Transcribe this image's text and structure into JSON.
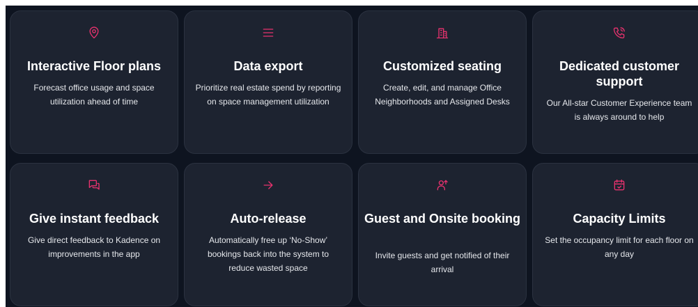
{
  "colors": {
    "background": "#0e1420",
    "card": "#1d2330",
    "accent": "#e8326e",
    "text": "#ffffff"
  },
  "cards": [
    {
      "icon": "map-pin-icon",
      "title": "Interactive Floor plans",
      "description": "Forecast office usage and space utilization ahead of time"
    },
    {
      "icon": "menu-lines-icon",
      "title": "Data export",
      "description": "Prioritize real estate spend by reporting on space management utilization"
    },
    {
      "icon": "building-icon",
      "title": "Customized seating",
      "description": "Create, edit, and manage Office Neighborhoods and Assigned Desks"
    },
    {
      "icon": "phone-call-icon",
      "title": "Dedicated customer support",
      "description": "Our All-star Customer Experience team is always around to help"
    },
    {
      "icon": "chat-bubbles-icon",
      "title": "Give instant feedback",
      "description": "Give direct feedback to Kadence on improvements in the app"
    },
    {
      "icon": "arrow-right-icon",
      "title": "Auto-release",
      "description": "Automatically free up ‘No-Show’ bookings back into the system to reduce wasted space"
    },
    {
      "icon": "user-arrow-icon",
      "title": "Guest and Onsite booking",
      "description": "Invite guests and get notified of their arrival"
    },
    {
      "icon": "calendar-check-icon",
      "title": "Capacity Limits",
      "description": "Set the occupancy limit for each floor on any day"
    }
  ]
}
